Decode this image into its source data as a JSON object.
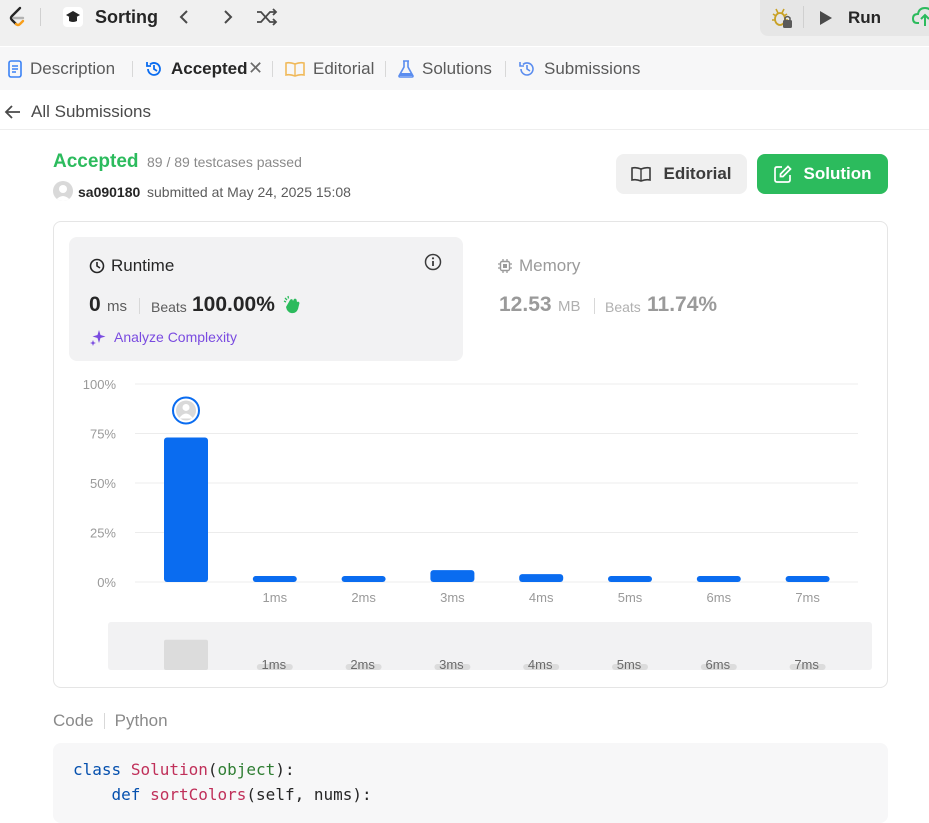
{
  "topbar": {
    "problem_title": "Sorting",
    "run_label": "Run"
  },
  "tabs": [
    {
      "label": "Description"
    },
    {
      "label": "Accepted"
    },
    {
      "label": "Editorial"
    },
    {
      "label": "Solutions"
    },
    {
      "label": "Submissions"
    }
  ],
  "back": {
    "label": "All Submissions"
  },
  "submission": {
    "status": "Accepted",
    "testcases": "89 / 89 testcases passed",
    "username": "sa090180",
    "submitted_text": "submitted at May 24, 2025 15:08",
    "editorial_button": "Editorial",
    "solution_button": "Solution"
  },
  "runtime": {
    "title": "Runtime",
    "value": "0",
    "unit": "ms",
    "beats_label": "Beats",
    "beats": "100.00%",
    "analyze_label": "Analyze Complexity"
  },
  "memory": {
    "title": "Memory",
    "value": "12.53",
    "unit": "MB",
    "beats_label": "Beats",
    "beats": "11.74%"
  },
  "chart_data": {
    "type": "bar",
    "categories": [
      "0ms",
      "1ms",
      "2ms",
      "3ms",
      "4ms",
      "5ms",
      "6ms",
      "7ms"
    ],
    "x_tick_labels": [
      "",
      "1ms",
      "2ms",
      "3ms",
      "4ms",
      "5ms",
      "6ms",
      "7ms"
    ],
    "values": [
      73,
      3,
      3,
      6,
      4,
      3,
      3,
      3
    ],
    "y_ticks": [
      "100%",
      "75%",
      "50%",
      "25%",
      "0%"
    ],
    "ylim": [
      0,
      100
    ],
    "highlight_index": 0,
    "bar_color": "#0a6cf0",
    "grid": true
  },
  "code": {
    "section_label": "Code",
    "language": "Python",
    "lines": {
      "l1_kw": "class",
      "l1_name": "Solution",
      "l1_base": "object",
      "l2_kw": "def",
      "l2_name": "sortColors",
      "l2_args": "self, nums"
    }
  },
  "colors": {
    "accent_green": "#2cbb5d",
    "bar_blue": "#0a6cf0",
    "analyze_purple": "#7a4be0"
  }
}
